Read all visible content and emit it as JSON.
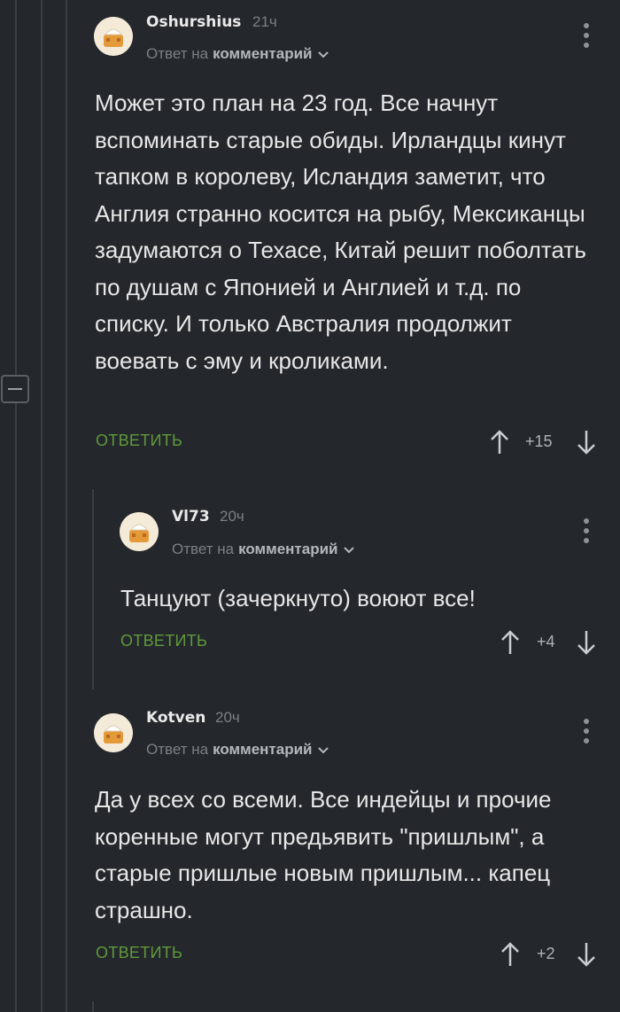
{
  "comments": [
    {
      "author": "Oshurshius",
      "time": "21ч",
      "reply_prefix": "Ответ на",
      "reply_target": "комментарий",
      "text": "Может это план на 23 год. Все начнут вспоминать старые обиды. Ирландцы кинут тапком в королеву, Исландия заметит, что Англия странно косится на рыбу, Мексиканцы задумаются о Техасе, Китай решит поболтать по душам с Японией и Англией и т.д. по списку. И только Австралия продолжит воевать с эму и кроликами.",
      "reply_label": "ОТВЕТИТЬ",
      "score": "+15"
    },
    {
      "author": "Vl73",
      "time": "20ч",
      "reply_prefix": "Ответ на",
      "reply_target": "комментарий",
      "text": "Танцуют (зачеркнуто) воюют все!",
      "reply_label": "ОТВЕТИТЬ",
      "score": "+4"
    },
    {
      "author": "Kotven",
      "time": "20ч",
      "reply_prefix": "Ответ на",
      "reply_target": "комментарий",
      "text": "Да у всех со всеми. Все индейцы и прочие коренные могут предьявить \"пришлым\", а старые пришлые новым пришлым... капец страшно.",
      "reply_label": "ОТВЕТИТЬ",
      "score": "+2"
    }
  ],
  "icons": {
    "collapse": "minus-box-icon",
    "more": "vertical-dots-icon",
    "upvote": "arrow-up-icon",
    "downvote": "arrow-down-icon",
    "avatar": "default-avatar-icon"
  },
  "colors": {
    "background": "#24272b",
    "reply_button": "#5f9a3c",
    "muted_text": "#7b8086"
  }
}
